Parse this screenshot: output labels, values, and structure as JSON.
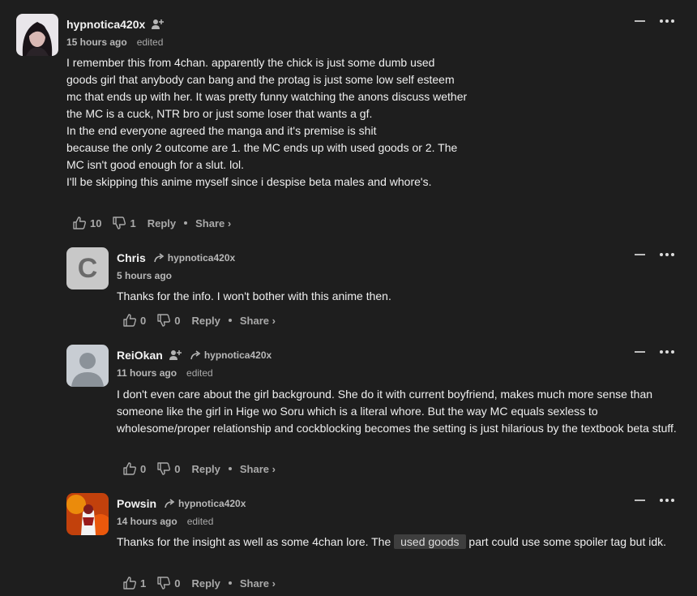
{
  "comments": [
    {
      "user": "hypnotica420x",
      "time": "15 hours ago",
      "edited": "edited",
      "paragraphs": [
        "I remember this from 4chan. apparently the chick is just some dumb used goods girl that anybody can bang and the protag is just some low self esteem mc that ends up with her. It was pretty funny watching the anons discuss wether the MC is a cuck, NTR bro or just some loser that wants a gf.",
        "In the end everyone agreed the manga and it's premise is shit",
        "because the only 2 outcome are 1. the MC ends up with used goods or 2. The MC isn't good enough for a slut. lol.",
        "I'll be skipping this anime myself since i despise beta males and whore's."
      ],
      "likes": "10",
      "dislikes": "1",
      "reply": "Reply",
      "share": "Share ›"
    },
    {
      "user": "Chris",
      "avatar_letter": "C",
      "reply_to": "hypnotica420x",
      "time": "5 hours ago",
      "text": "Thanks for the info. I won't bother with this anime then.",
      "likes": "0",
      "dislikes": "0",
      "reply": "Reply",
      "share": "Share ›"
    },
    {
      "user": "ReiOkan",
      "reply_to": "hypnotica420x",
      "time": "11 hours ago",
      "edited": "edited",
      "text": "I don't even care about the girl background. She do it with current boyfriend, makes much more sense than someone like the girl in Hige wo Soru which is a literal whore. But the way MC equals sexless to wholesome/proper relationship and cockblocking becomes the setting is just hilarious by the textbook beta stuff.",
      "likes": "0",
      "dislikes": "0",
      "reply": "Reply",
      "share": "Share ›"
    },
    {
      "user": "Powsin",
      "reply_to": "hypnotica420x",
      "time": "14 hours ago",
      "edited": "edited",
      "text_before": "Thanks for the insight as well as some 4chan lore. The ",
      "spoiler": "used goods",
      "text_after": " part could use some spoiler tag but idk.",
      "likes": "1",
      "dislikes": "0",
      "reply": "Reply",
      "share": "Share ›"
    }
  ]
}
